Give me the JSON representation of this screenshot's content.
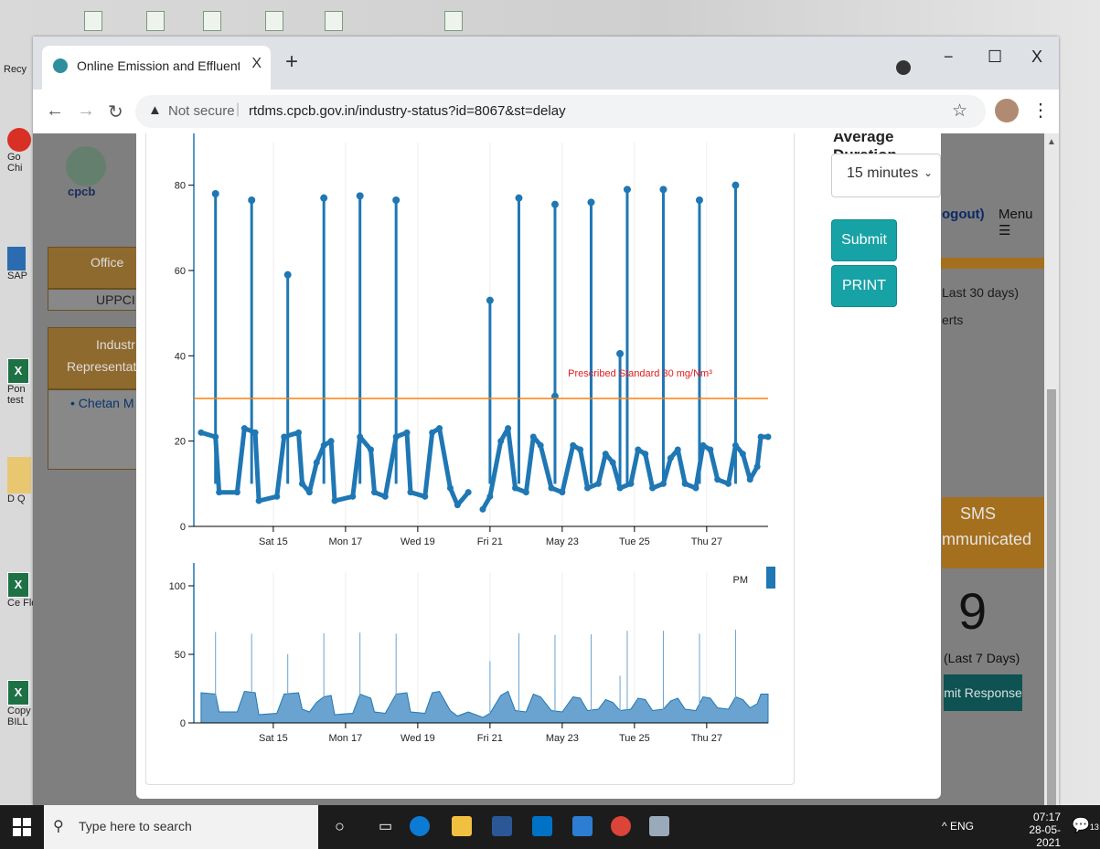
{
  "desktop": {
    "icons": [
      {
        "label": "Recy",
        "top": 80,
        "kind": "bin"
      },
      {
        "label": "Go Chi",
        "top": 200,
        "kind": "chrome"
      },
      {
        "label": "SAP",
        "top": 320,
        "kind": "sap"
      },
      {
        "label": "Pon test",
        "top": 440,
        "kind": "xls"
      },
      {
        "label": "D Q",
        "top": 560,
        "kind": "folder"
      },
      {
        "label": "Ce Flo",
        "top": 670,
        "kind": "xls"
      },
      {
        "label": "Copy BILL",
        "top": 790,
        "kind": "xls"
      }
    ]
  },
  "browser": {
    "tab_title": "Online Emission and Effluent Mo",
    "tab_close": "X",
    "new_tab": "+",
    "window_min": "−",
    "window_max": "☐",
    "window_close": "X",
    "security_label": "Not secure",
    "url": "rtdms.cpcb.gov.in/industry-status?id=8067&st=delay"
  },
  "page": {
    "logo_text": "cpcb",
    "office_label": "Office",
    "office_value": "UPPCI",
    "industry_label_1": "Industr",
    "industry_label_2": "Representat",
    "contact": "• Chetan M",
    "logout": "ogout)",
    "menu": "Menu ☰",
    "last30": "Last 30 days)",
    "alerts": "erts",
    "sms_line1": "SMS",
    "sms_line2": "mmunicated",
    "sms_count": "9",
    "last7": "(Last 7 Days)",
    "response_button": "mit Response"
  },
  "modal": {
    "average_label": "Average Duration",
    "duration_value": "15 minutes",
    "submit_label": "Submit",
    "print_label": "PRINT"
  },
  "chart_data": [
    {
      "type": "line",
      "x_ticks": [
        "Sat 15",
        "Mon 17",
        "Wed 19",
        "Fri 21",
        "May 23",
        "Tue 25",
        "Thu 27"
      ],
      "y_ticks": [
        0,
        20,
        40,
        60,
        80
      ],
      "ylim": [
        0,
        90
      ],
      "xlim": [
        12.8,
        28.7
      ],
      "series_color": "#1f77b4",
      "standard_line": {
        "value": 30,
        "label": "Prescribed Standard 30 mg/Nm³",
        "color": "#ff7f0e",
        "label_color": "#e31a1c"
      },
      "baseline": [
        [
          13.0,
          22
        ],
        [
          13.4,
          21
        ],
        [
          13.5,
          8
        ],
        [
          14.0,
          8
        ],
        [
          14.2,
          23
        ],
        [
          14.5,
          22
        ],
        [
          14.6,
          6
        ],
        [
          15.1,
          7
        ],
        [
          15.3,
          21
        ],
        [
          15.7,
          22
        ],
        [
          15.8,
          10
        ],
        [
          16.0,
          8
        ],
        [
          16.2,
          15
        ],
        [
          16.4,
          19
        ],
        [
          16.6,
          20
        ],
        [
          16.7,
          6
        ],
        [
          17.2,
          7
        ],
        [
          17.4,
          21
        ],
        [
          17.7,
          18
        ],
        [
          17.8,
          8
        ],
        [
          18.1,
          7
        ],
        [
          18.4,
          21
        ],
        [
          18.7,
          22
        ],
        [
          18.8,
          8
        ],
        [
          19.2,
          7
        ],
        [
          19.4,
          22
        ],
        [
          19.6,
          23
        ],
        [
          19.9,
          9
        ],
        [
          20.1,
          5
        ],
        [
          20.4,
          8
        ],
        [
          20.8,
          4
        ],
        [
          21.0,
          7
        ],
        [
          21.3,
          20
        ],
        [
          21.5,
          23
        ],
        [
          21.7,
          9
        ],
        [
          22.0,
          8
        ],
        [
          22.2,
          21
        ],
        [
          22.4,
          19
        ],
        [
          22.7,
          9
        ],
        [
          23.0,
          8
        ],
        [
          23.3,
          19
        ],
        [
          23.5,
          18
        ],
        [
          23.7,
          9
        ],
        [
          24.0,
          10
        ],
        [
          24.2,
          17
        ],
        [
          24.4,
          15
        ],
        [
          24.6,
          9
        ],
        [
          24.9,
          10
        ],
        [
          25.1,
          18
        ],
        [
          25.3,
          17
        ],
        [
          25.5,
          9
        ],
        [
          25.8,
          10
        ],
        [
          26.0,
          16
        ],
        [
          26.2,
          18
        ],
        [
          26.4,
          10
        ],
        [
          26.7,
          9
        ],
        [
          26.9,
          19
        ],
        [
          27.1,
          18
        ],
        [
          27.3,
          11
        ],
        [
          27.6,
          10
        ],
        [
          27.8,
          19
        ],
        [
          28.0,
          17
        ],
        [
          28.2,
          11
        ],
        [
          28.4,
          14
        ],
        [
          28.5,
          21
        ],
        [
          28.7,
          21
        ]
      ],
      "spikes": [
        [
          13.4,
          78
        ],
        [
          14.4,
          76.5
        ],
        [
          15.4,
          59
        ],
        [
          16.4,
          77
        ],
        [
          17.4,
          77.5
        ],
        [
          18.4,
          76.5
        ],
        [
          21.0,
          53
        ],
        [
          21.8,
          77
        ],
        [
          22.8,
          75.5
        ],
        [
          22.8,
          30.5
        ],
        [
          23.8,
          76
        ],
        [
          24.6,
          40.5
        ],
        [
          24.8,
          79
        ],
        [
          25.8,
          79
        ],
        [
          26.8,
          76.5
        ],
        [
          27.8,
          80
        ]
      ]
    },
    {
      "type": "area",
      "legend": "PM",
      "y_ticks": [
        0,
        50,
        100
      ],
      "ylim": [
        0,
        110
      ],
      "x_ticks": [
        "Sat 15",
        "Mon 17",
        "Wed 19",
        "Fri 21",
        "May 23",
        "Tue 25",
        "Thu 27"
      ],
      "series_color": "#1f77b4"
    }
  ],
  "taskbar": {
    "search_placeholder": "Type here to search",
    "tray": "^  ENG",
    "time": "07:17",
    "date": "28-05-2021",
    "notifications": "13"
  }
}
